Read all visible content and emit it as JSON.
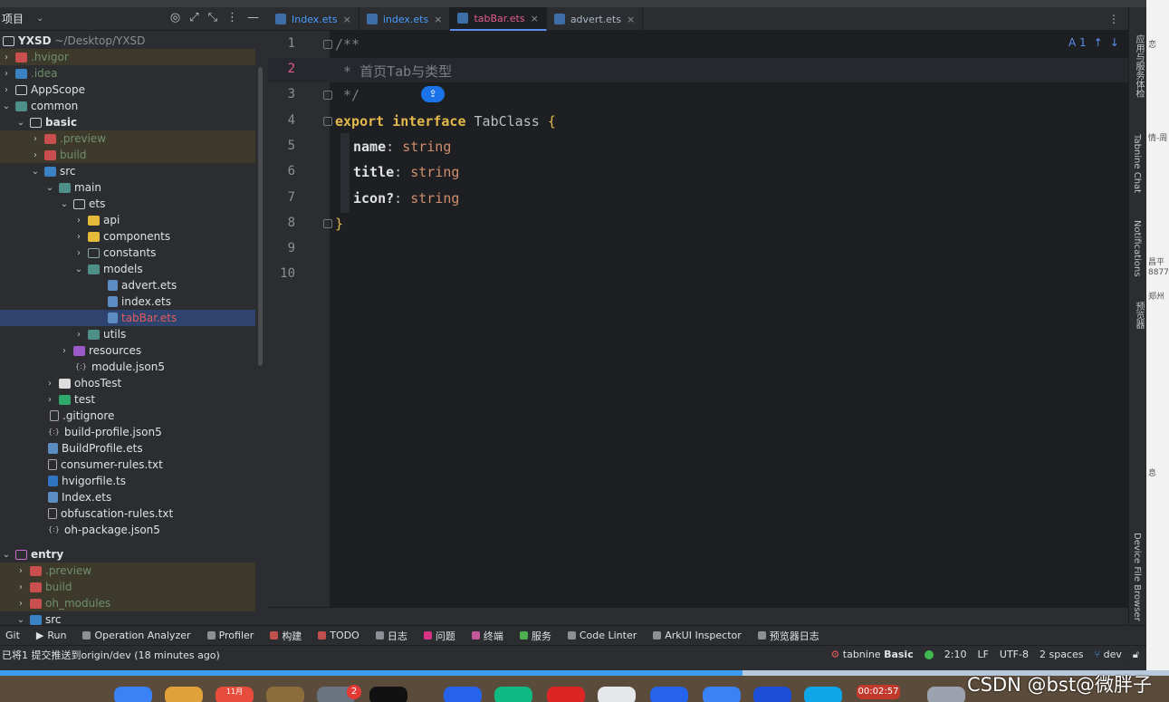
{
  "project_panel": {
    "title": "项目",
    "tree": [
      {
        "label": "YXSD",
        "suffix": "~/Desktop/YXSD"
      },
      {
        "label": ".hvigor"
      },
      {
        "label": ".idea"
      },
      {
        "label": "AppScope"
      },
      {
        "label": "common"
      },
      {
        "label": "basic"
      },
      {
        "label": ".preview"
      },
      {
        "label": "build"
      },
      {
        "label": "src"
      },
      {
        "label": "main"
      },
      {
        "label": "ets"
      },
      {
        "label": "api"
      },
      {
        "label": "components"
      },
      {
        "label": "constants"
      },
      {
        "label": "models"
      },
      {
        "label": "advert.ets"
      },
      {
        "label": "index.ets"
      },
      {
        "label": "tabBar.ets"
      },
      {
        "label": "utils"
      },
      {
        "label": "resources"
      },
      {
        "label": "module.json5"
      },
      {
        "label": "ohosTest"
      },
      {
        "label": "test"
      },
      {
        "label": ".gitignore"
      },
      {
        "label": "build-profile.json5"
      },
      {
        "label": "BuildProfile.ets"
      },
      {
        "label": "consumer-rules.txt"
      },
      {
        "label": "hvigorfile.ts"
      },
      {
        "label": "Index.ets"
      },
      {
        "label": "obfuscation-rules.txt"
      },
      {
        "label": "oh-package.json5"
      },
      {
        "label": "entry"
      },
      {
        "label": ".preview"
      },
      {
        "label": "build"
      },
      {
        "label": "oh_modules"
      },
      {
        "label": "src"
      }
    ]
  },
  "tabs": [
    {
      "label": "Index.ets"
    },
    {
      "label": "index.ets"
    },
    {
      "label": "tabBar.ets"
    },
    {
      "label": "advert.ets"
    }
  ],
  "editor": {
    "line_numbers": [
      "1",
      "2",
      "3",
      "4",
      "5",
      "6",
      "7",
      "8",
      "9",
      "10"
    ],
    "lines": {
      "l1": "/**",
      "l2": " * 首页Tab与类型",
      "l3": " */",
      "l4_kw1": "export",
      "l4_kw2": "interface",
      "l4_cls": "TabClass",
      "l4_brace": "{",
      "l5_prop": "name",
      "l5_type": "string",
      "l6_prop": "title",
      "l6_type": "string",
      "l7_prop": "icon?",
      "l7_type": "string",
      "l8": "}"
    },
    "inspection": "A 1"
  },
  "right_strip": {
    "items": [
      "应用与服务体检",
      "Tabnine Chat",
      "Notifications",
      "预览器",
      "Device File Browser"
    ]
  },
  "tool_windows": [
    "Git",
    "Run",
    "Operation Analyzer",
    "Profiler",
    "构建",
    "TODO",
    "日志",
    "问题",
    "终端",
    "服务",
    "Code Linter",
    "ArkUI Inspector",
    "预览器日志"
  ],
  "status": {
    "message": "已将1 提交推送到origin/dev (18 minutes ago)",
    "tabnine": "tabnine",
    "tabnine_plan": "Basic",
    "position": "2:10",
    "line_sep": "LF",
    "encoding": "UTF-8",
    "indent": "2 spaces",
    "branch": "dev"
  },
  "overlay": {
    "watermark": "CSDN @bst@微胖子",
    "timer": "00:02:57",
    "badge": "2",
    "calendar": "11月"
  },
  "outside_text": [
    "恋",
    "情-周",
    "昌平",
    "8877",
    "郑州",
    "息"
  ]
}
